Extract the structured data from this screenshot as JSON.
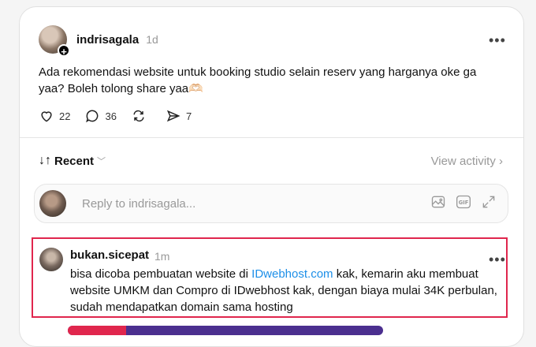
{
  "post": {
    "username": "indrisagala",
    "time": "1d",
    "text": "Ada rekomendasi website untuk booking studio selain reserv yang harganya oke ga yaa? Boleh tolong share yaa🫶🏻",
    "likes": "22",
    "comments": "36",
    "shares": "7"
  },
  "sort": {
    "label": "Recent",
    "view_activity": "View activity"
  },
  "reply": {
    "placeholder": "Reply to indrisagala..."
  },
  "comment": {
    "username": "bukan.sicepat",
    "time": "1m",
    "text_before": "bisa dicoba pembuatan website di ",
    "link": "IDwebhost.com",
    "text_after": " kak, kemarin aku membuat website UMKM dan Compro di IDwebhost kak, dengan biaya mulai 34K perbulan, sudah mendapatkan domain sama hosting"
  },
  "colors": {
    "highlight": "#e0264d",
    "link": "#1d8fe8"
  }
}
